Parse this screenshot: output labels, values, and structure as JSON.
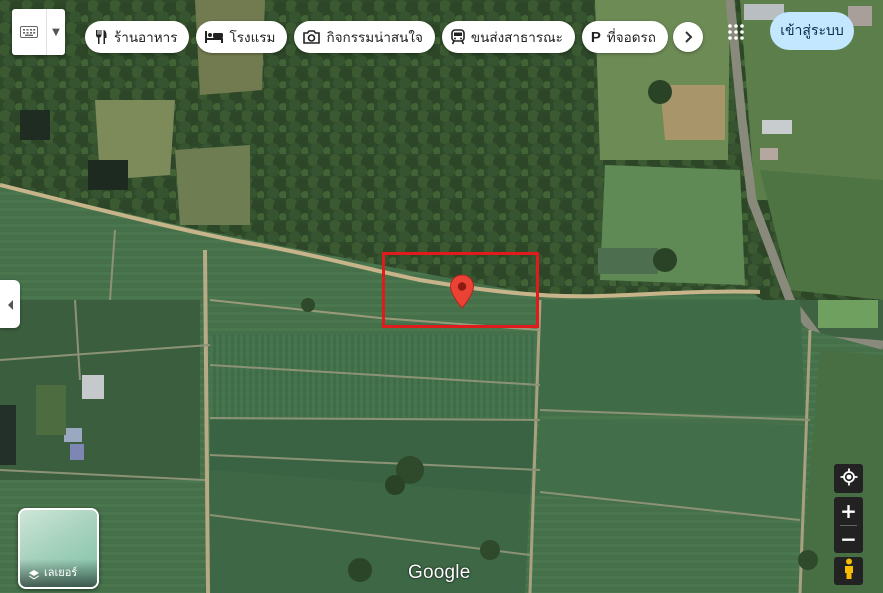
{
  "map": {
    "type": "satellite",
    "pin_color": "#ea4335",
    "highlight_color": "#e01b1b"
  },
  "toolbar": {
    "keyboard_icon": "keyboard-icon",
    "chips": [
      {
        "label": "ร้านอาหาร",
        "icon": "restaurant-icon"
      },
      {
        "label": "โรงแรม",
        "icon": "hotel-icon"
      },
      {
        "label": "กิจกรรมน่าสนใจ",
        "icon": "camera-icon"
      },
      {
        "label": "ขนส่งสาธารณะ",
        "icon": "transit-icon"
      },
      {
        "label": "ที่จอดรถ",
        "icon": "parking-icon"
      }
    ],
    "more_icon": "chevron-right-icon"
  },
  "header": {
    "apps_icon": "apps-grid-icon",
    "sign_in_label": "เข้าสู่ระบบ",
    "sign_in_color": "#c2e7ff"
  },
  "layers": {
    "label": "เลเยอร์"
  },
  "controls": {
    "zoom_in": "+",
    "zoom_out": "−"
  },
  "branding": {
    "logo_text": "Google"
  }
}
